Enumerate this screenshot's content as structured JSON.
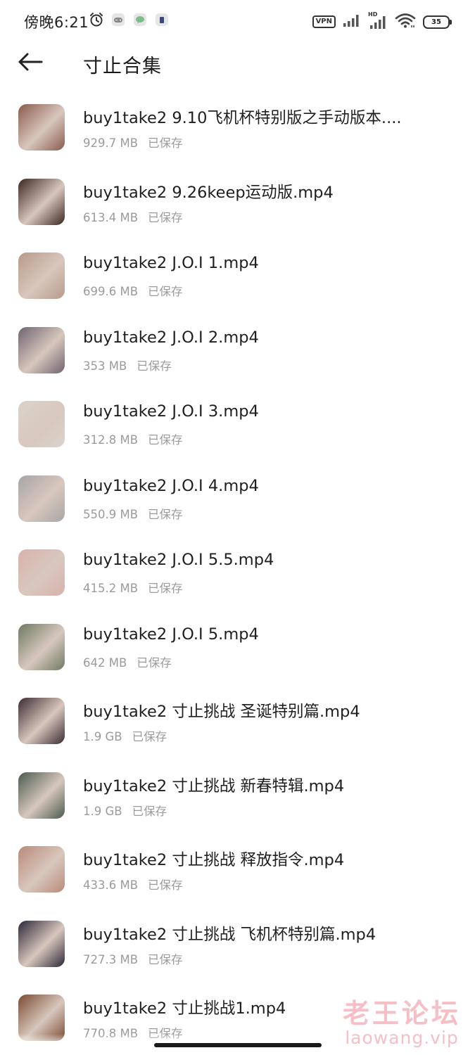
{
  "status_bar": {
    "time": "傍晚6:21",
    "vpn_label": "VPN",
    "network_label": "HD",
    "battery_level": "35",
    "left_icons": [
      "alarm-icon",
      "game-controller-icon",
      "chat-bubble-icon",
      "app-icon"
    ],
    "right_icons": [
      "vpn-icon",
      "signal-icon",
      "hd-signal-icon",
      "wifi-icon",
      "battery-icon"
    ]
  },
  "header": {
    "back_icon": "back-arrow-icon",
    "title": "寸止合集"
  },
  "files": [
    {
      "name": "buy1take2 9.10飞机杯特别版之手动版本....",
      "size": "929.7 MB",
      "status": "已保存",
      "thumb_color": "#8a5a4e"
    },
    {
      "name": "buy1take2 9.26keep运动版.mp4",
      "size": "613.4 MB",
      "status": "已保存",
      "thumb_color": "#3a2620"
    },
    {
      "name": "buy1take2 J.O.I 1.mp4",
      "size": "699.6 MB",
      "status": "已保存",
      "thumb_color": "#b89a8a"
    },
    {
      "name": "buy1take2 J.O.I 2.mp4",
      "size": "353 MB",
      "status": "已保存",
      "thumb_color": "#6e6470"
    },
    {
      "name": "buy1take2 J.O.I 3.mp4",
      "size": "312.8 MB",
      "status": "已保存",
      "thumb_color": "#d9d4cc"
    },
    {
      "name": "buy1take2 J.O.I 4.mp4",
      "size": "550.9 MB",
      "status": "已保存",
      "thumb_color": "#a7a5a8"
    },
    {
      "name": "buy1take2 J.O.I 5.5.mp4",
      "size": "415.2 MB",
      "status": "已保存",
      "thumb_color": "#d7b3ad"
    },
    {
      "name": "buy1take2 J.O.I 5.mp4",
      "size": "642 MB",
      "status": "已保存",
      "thumb_color": "#6d7a62"
    },
    {
      "name": "buy1take2 寸止挑战 圣诞特别篇.mp4",
      "size": "1.9 GB",
      "status": "已保存",
      "thumb_color": "#3b2a33"
    },
    {
      "name": "buy1take2 寸止挑战 新春特辑.mp4",
      "size": "1.9 GB",
      "status": "已保存",
      "thumb_color": "#4a5a4e"
    },
    {
      "name": "buy1take2 寸止挑战 释放指令.mp4",
      "size": "433.6 MB",
      "status": "已保存",
      "thumb_color": "#b98a7a"
    },
    {
      "name": "buy1take2 寸止挑战 飞机杯特别篇.mp4",
      "size": "727.3 MB",
      "status": "已保存",
      "thumb_color": "#2c2738"
    },
    {
      "name": "buy1take2 寸止挑战1.mp4",
      "size": "770.8 MB",
      "status": "已保存",
      "thumb_color": "#7a4a32"
    }
  ],
  "watermark": {
    "text_cn": "老王论坛",
    "text_en": "laowang.vip",
    "color": "#f08a97"
  }
}
